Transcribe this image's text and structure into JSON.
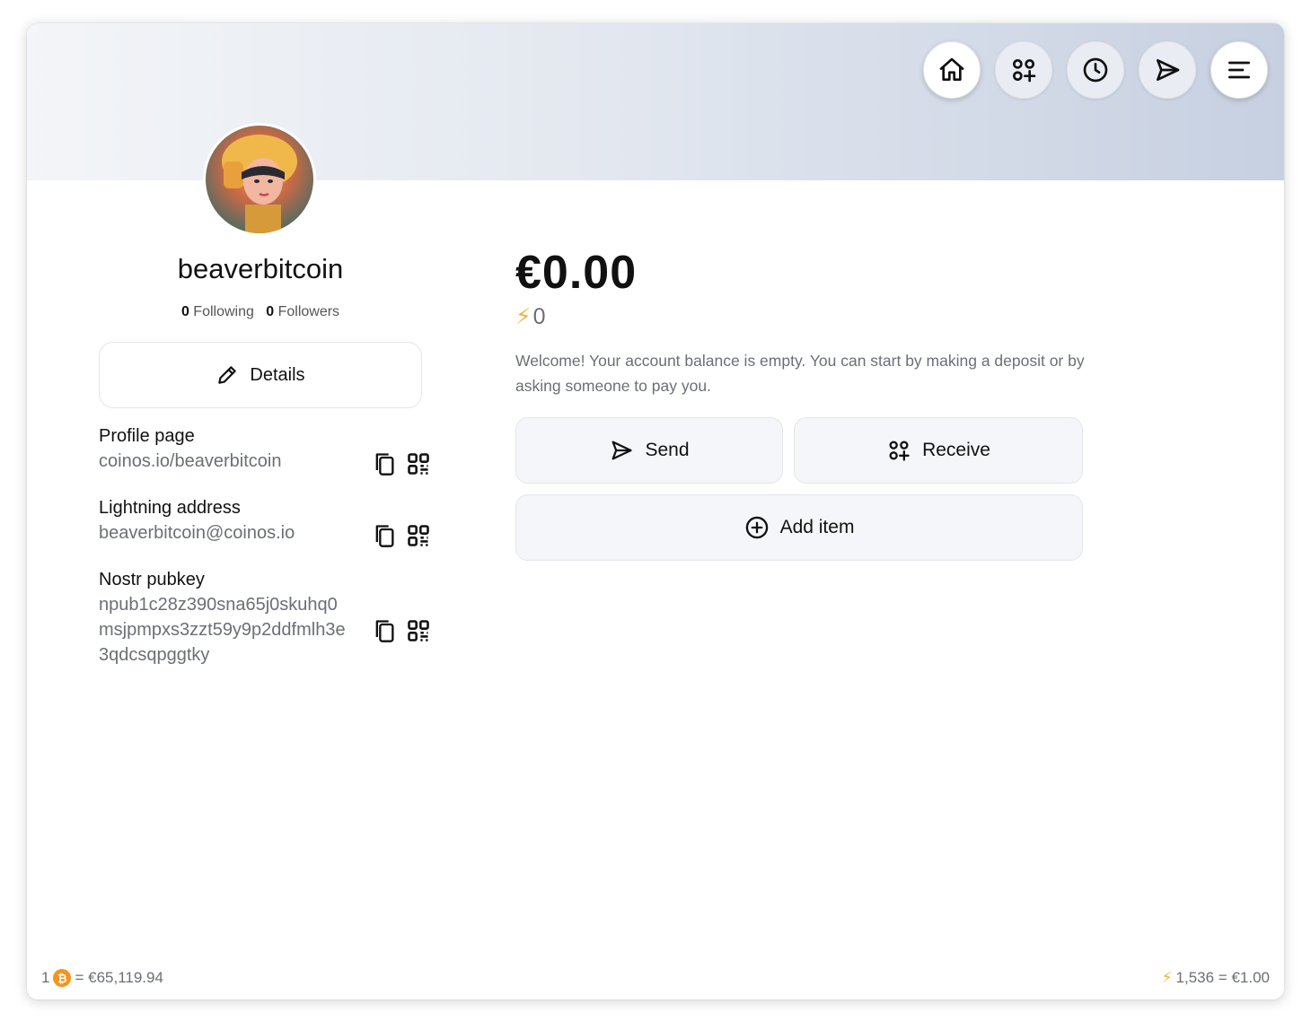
{
  "nav": {
    "items": [
      {
        "name": "home",
        "icon": "home-icon"
      },
      {
        "name": "apps",
        "icon": "grid-plus-icon"
      },
      {
        "name": "history",
        "icon": "clock-icon"
      },
      {
        "name": "send",
        "icon": "send-icon"
      },
      {
        "name": "menu",
        "icon": "menu-icon"
      }
    ]
  },
  "profile": {
    "username": "beaverbitcoin",
    "following_count": "0",
    "following_label": "Following",
    "followers_count": "0",
    "followers_label": "Followers",
    "details_label": "Details"
  },
  "info": {
    "profile_page": {
      "label": "Profile page",
      "value": "coinos.io/beaverbitcoin"
    },
    "lightning_address": {
      "label": "Lightning address",
      "value": "beaverbitcoin@coinos.io"
    },
    "nostr_pubkey": {
      "label": "Nostr pubkey",
      "value": "npub1c28z390sna65j0skuhq0msjpmpxs3zzt59y9p2ddfmlh3e3qdcsqpggtky"
    }
  },
  "wallet": {
    "balance": "€0.00",
    "sats": "0",
    "welcome": "Welcome! Your account balance is empty. You can start by making a deposit or by asking someone to pay you.",
    "send_label": "Send",
    "receive_label": "Receive",
    "add_item_label": "Add item"
  },
  "footer": {
    "btc_left": "1",
    "btc_rate": "= €65,119.94",
    "sats_rate": "1,536 = €1.00"
  },
  "colors": {
    "bolt": "#f3b33d",
    "bitcoin": "#f7931a",
    "muted_text": "#6b6f76",
    "button_bg": "#f5f6f9"
  }
}
